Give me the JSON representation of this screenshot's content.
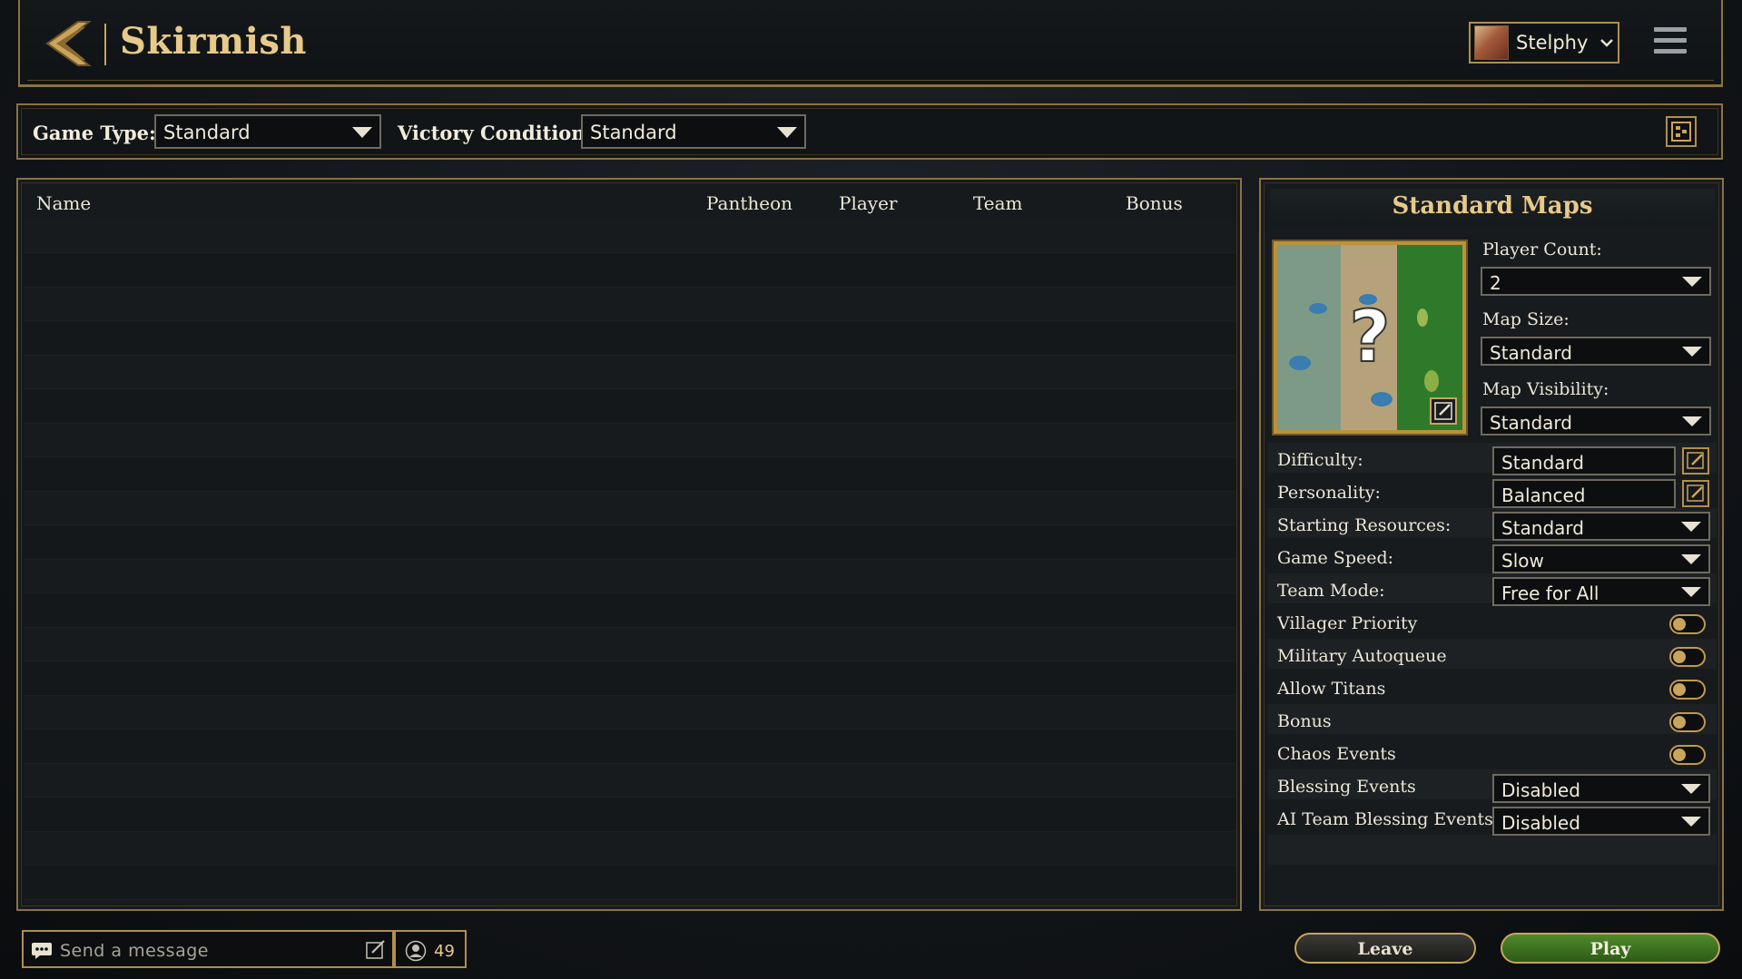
{
  "header": {
    "title": "Skirmish",
    "user_name": "Stelphy"
  },
  "filters": {
    "game_type_label": "Game Type:",
    "game_type_value": "Standard",
    "victory_label": "Victory Condition:",
    "victory_value": "Standard"
  },
  "player_list": {
    "columns": [
      "Name",
      "Pantheon",
      "Player",
      "Team",
      "Bonus"
    ],
    "rows": []
  },
  "settings": {
    "title": "Standard Maps",
    "player_count_label": "Player Count:",
    "player_count_value": "2",
    "map_size_label": "Map Size:",
    "map_size_value": "Standard",
    "map_visibility_label": "Map Visibility:",
    "map_visibility_value": "Standard",
    "difficulty_label": "Difficulty:",
    "difficulty_value": "Standard",
    "personality_label": "Personality:",
    "personality_value": "Balanced",
    "starting_resources_label": "Starting Resources:",
    "starting_resources_value": "Standard",
    "game_speed_label": "Game Speed:",
    "game_speed_value": "Slow",
    "team_mode_label": "Team Mode:",
    "team_mode_value": "Free for All",
    "toggles": [
      {
        "label": "Villager Priority",
        "on": false
      },
      {
        "label": "Military Autoqueue",
        "on": false
      },
      {
        "label": "Allow Titans",
        "on": false
      },
      {
        "label": "Bonus",
        "on": false
      },
      {
        "label": "Chaos Events",
        "on": false
      }
    ],
    "blessing_events_label": "Blessing Events",
    "blessing_events_value": "Disabled",
    "ai_blessing_label": "AI Team Blessing Events",
    "ai_blessing_value": "Disabled"
  },
  "footer": {
    "chat_placeholder": "Send a message",
    "online_count": "49",
    "leave_label": "Leave",
    "play_label": "Play"
  },
  "colors": {
    "gold_border": "#8a7342",
    "title_gold": "#e7c98a",
    "play_green": "#3f7522"
  },
  "icons": [
    "back-arrow-icon",
    "chevron-down-icon",
    "hamburger-menu-icon",
    "layout-toggle-icon",
    "edit-icon",
    "chat-bubble-icon",
    "compose-icon",
    "user-count-icon",
    "question-mark-icon"
  ]
}
